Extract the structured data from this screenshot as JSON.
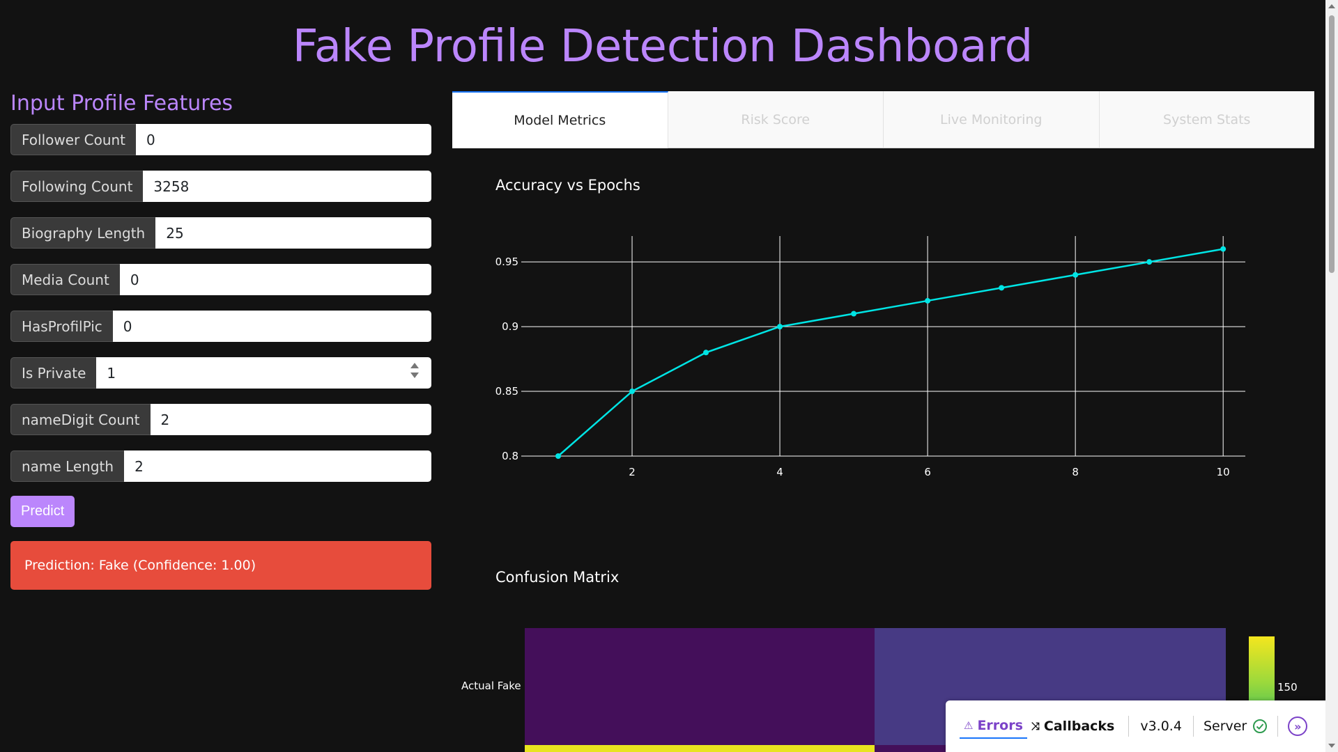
{
  "header": {
    "title": "Fake Profile Detection Dashboard"
  },
  "form": {
    "heading": "Input Profile Features",
    "fields": [
      {
        "label": "Follower Count",
        "value": "0"
      },
      {
        "label": "Following Count",
        "value": "3258"
      },
      {
        "label": "Biography Length",
        "value": "25"
      },
      {
        "label": "Media Count",
        "value": "0"
      },
      {
        "label": "HasProfilPic",
        "value": "0"
      },
      {
        "label": "Is Private",
        "value": "1"
      },
      {
        "label": "nameDigit Count",
        "value": "2"
      },
      {
        "label": "name Length",
        "value": "2"
      }
    ],
    "predict_label": "Predict",
    "prediction_text": "Prediction: Fake (Confidence: 1.00)"
  },
  "tabs": [
    "Model Metrics",
    "Risk Score",
    "Live Monitoring",
    "System Stats"
  ],
  "active_tab": "Model Metrics",
  "chart_data": [
    {
      "type": "line",
      "title": "Accuracy vs Epochs",
      "x": [
        1,
        2,
        3,
        4,
        5,
        6,
        7,
        8,
        9,
        10
      ],
      "series": [
        {
          "values": [
            0.8,
            0.85,
            0.88,
            0.9,
            0.91,
            0.92,
            0.93,
            0.94,
            0.95,
            0.96
          ],
          "color": "#00e5e5"
        }
      ],
      "xticks": [
        "2",
        "4",
        "6",
        "8",
        "10"
      ],
      "yticks": [
        "0.8",
        "0.85",
        "0.9",
        "0.95"
      ],
      "xlim": [
        0.5,
        10.3
      ],
      "ylim": [
        0.8,
        0.97
      ],
      "grid": true
    },
    {
      "type": "heatmap",
      "title": "Confusion Matrix",
      "rows": [
        "Actual Fake"
      ],
      "colorscale": "viridis",
      "colorbar_tick": "150",
      "cells": [
        {
          "row": "Actual Fake",
          "col": 0,
          "color": "#440f5a"
        },
        {
          "row": "Actual Fake",
          "col": 1,
          "color": "#473a84"
        }
      ]
    }
  ],
  "devtools": {
    "errors_label": "Errors",
    "callbacks_label": "Callbacks",
    "version": "v3.0.4",
    "server_label": "Server"
  },
  "colors": {
    "accent": "#bb86fc",
    "danger": "#e74c3c",
    "line": "#00e5e5",
    "background": "#121212"
  }
}
